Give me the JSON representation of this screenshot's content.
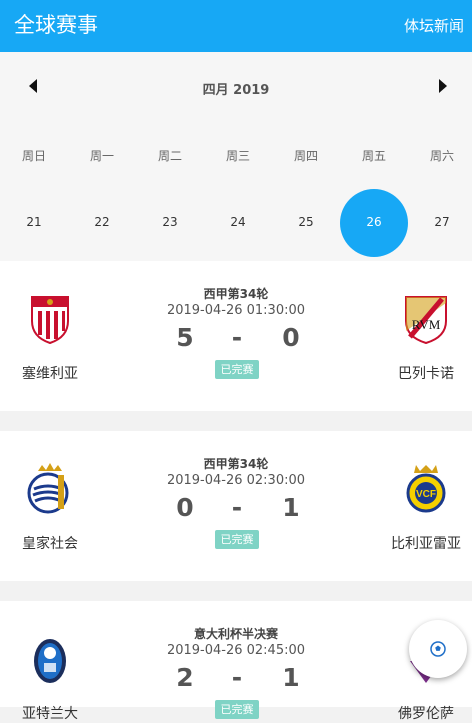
{
  "header": {
    "title": "全球赛事",
    "news_link": "体坛新闻"
  },
  "calendar": {
    "month": "四月 2019",
    "weekdays": [
      "周日",
      "周一",
      "周二",
      "周三",
      "周四",
      "周五",
      "周六"
    ],
    "days": [
      "21",
      "22",
      "23",
      "24",
      "25",
      "26",
      "27"
    ],
    "selected_day": "26"
  },
  "matches": [
    {
      "league": "西甲第34轮",
      "time": "2019-04-26 01:30:00",
      "home_score": "5",
      "separator": "-",
      "away_score": "0",
      "status": "已完赛",
      "home_team": "塞维利亚",
      "away_team": "巴列卡诺",
      "home_logo_text": "",
      "away_logo_text": "RVM"
    },
    {
      "league": "西甲第34轮",
      "time": "2019-04-26 02:30:00",
      "home_score": "0",
      "separator": "-",
      "away_score": "1",
      "status": "已完赛",
      "home_team": "皇家社会",
      "away_team": "比利亚雷亚",
      "away_logo_text": "VCF"
    },
    {
      "league": "意大利杯半决赛",
      "time": "2019-04-26 02:45:00",
      "home_score": "2",
      "separator": "-",
      "away_score": "1",
      "status": "已完赛",
      "home_team": "亚特兰大",
      "away_team": "佛罗伦萨"
    }
  ],
  "colors": {
    "brand": "#17a8f5",
    "status": "#7fd3c5"
  },
  "fab": {
    "icon": "soccer-ball-icon"
  }
}
